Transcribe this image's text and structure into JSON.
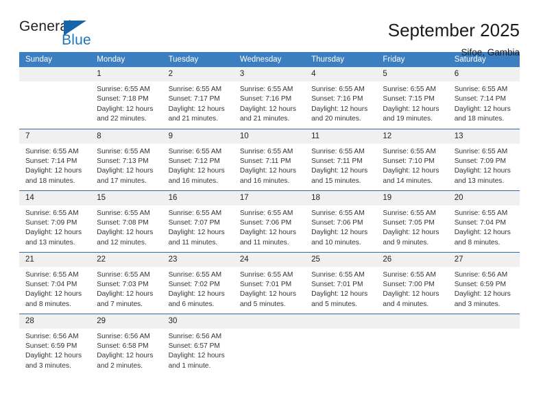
{
  "brand": {
    "name_part1": "General",
    "name_part2": "Blue",
    "flag_color": "#1565a8",
    "blue_color": "#1b75bb"
  },
  "header": {
    "title": "September 2025",
    "location": "Sifoe, Gambia",
    "header_bg": "#3c7fc1",
    "separator_color": "#2b6ca8",
    "daynum_bg": "#f0f0f0"
  },
  "weekdays": [
    "Sunday",
    "Monday",
    "Tuesday",
    "Wednesday",
    "Thursday",
    "Friday",
    "Saturday"
  ],
  "labels": {
    "sunrise": "Sunrise:",
    "sunset": "Sunset:",
    "daylight": "Daylight:"
  },
  "weeks": [
    [
      {
        "day": "",
        "empty": true
      },
      {
        "day": "1",
        "sunrise": "Sunrise: 6:55 AM",
        "sunset": "Sunset: 7:18 PM",
        "daylight": "Daylight: 12 hours and 22 minutes."
      },
      {
        "day": "2",
        "sunrise": "Sunrise: 6:55 AM",
        "sunset": "Sunset: 7:17 PM",
        "daylight": "Daylight: 12 hours and 21 minutes."
      },
      {
        "day": "3",
        "sunrise": "Sunrise: 6:55 AM",
        "sunset": "Sunset: 7:16 PM",
        "daylight": "Daylight: 12 hours and 21 minutes."
      },
      {
        "day": "4",
        "sunrise": "Sunrise: 6:55 AM",
        "sunset": "Sunset: 7:16 PM",
        "daylight": "Daylight: 12 hours and 20 minutes."
      },
      {
        "day": "5",
        "sunrise": "Sunrise: 6:55 AM",
        "sunset": "Sunset: 7:15 PM",
        "daylight": "Daylight: 12 hours and 19 minutes."
      },
      {
        "day": "6",
        "sunrise": "Sunrise: 6:55 AM",
        "sunset": "Sunset: 7:14 PM",
        "daylight": "Daylight: 12 hours and 18 minutes."
      }
    ],
    [
      {
        "day": "7",
        "sunrise": "Sunrise: 6:55 AM",
        "sunset": "Sunset: 7:14 PM",
        "daylight": "Daylight: 12 hours and 18 minutes."
      },
      {
        "day": "8",
        "sunrise": "Sunrise: 6:55 AM",
        "sunset": "Sunset: 7:13 PM",
        "daylight": "Daylight: 12 hours and 17 minutes."
      },
      {
        "day": "9",
        "sunrise": "Sunrise: 6:55 AM",
        "sunset": "Sunset: 7:12 PM",
        "daylight": "Daylight: 12 hours and 16 minutes."
      },
      {
        "day": "10",
        "sunrise": "Sunrise: 6:55 AM",
        "sunset": "Sunset: 7:11 PM",
        "daylight": "Daylight: 12 hours and 16 minutes."
      },
      {
        "day": "11",
        "sunrise": "Sunrise: 6:55 AM",
        "sunset": "Sunset: 7:11 PM",
        "daylight": "Daylight: 12 hours and 15 minutes."
      },
      {
        "day": "12",
        "sunrise": "Sunrise: 6:55 AM",
        "sunset": "Sunset: 7:10 PM",
        "daylight": "Daylight: 12 hours and 14 minutes."
      },
      {
        "day": "13",
        "sunrise": "Sunrise: 6:55 AM",
        "sunset": "Sunset: 7:09 PM",
        "daylight": "Daylight: 12 hours and 13 minutes."
      }
    ],
    [
      {
        "day": "14",
        "sunrise": "Sunrise: 6:55 AM",
        "sunset": "Sunset: 7:09 PM",
        "daylight": "Daylight: 12 hours and 13 minutes."
      },
      {
        "day": "15",
        "sunrise": "Sunrise: 6:55 AM",
        "sunset": "Sunset: 7:08 PM",
        "daylight": "Daylight: 12 hours and 12 minutes."
      },
      {
        "day": "16",
        "sunrise": "Sunrise: 6:55 AM",
        "sunset": "Sunset: 7:07 PM",
        "daylight": "Daylight: 12 hours and 11 minutes."
      },
      {
        "day": "17",
        "sunrise": "Sunrise: 6:55 AM",
        "sunset": "Sunset: 7:06 PM",
        "daylight": "Daylight: 12 hours and 11 minutes."
      },
      {
        "day": "18",
        "sunrise": "Sunrise: 6:55 AM",
        "sunset": "Sunset: 7:06 PM",
        "daylight": "Daylight: 12 hours and 10 minutes."
      },
      {
        "day": "19",
        "sunrise": "Sunrise: 6:55 AM",
        "sunset": "Sunset: 7:05 PM",
        "daylight": "Daylight: 12 hours and 9 minutes."
      },
      {
        "day": "20",
        "sunrise": "Sunrise: 6:55 AM",
        "sunset": "Sunset: 7:04 PM",
        "daylight": "Daylight: 12 hours and 8 minutes."
      }
    ],
    [
      {
        "day": "21",
        "sunrise": "Sunrise: 6:55 AM",
        "sunset": "Sunset: 7:04 PM",
        "daylight": "Daylight: 12 hours and 8 minutes."
      },
      {
        "day": "22",
        "sunrise": "Sunrise: 6:55 AM",
        "sunset": "Sunset: 7:03 PM",
        "daylight": "Daylight: 12 hours and 7 minutes."
      },
      {
        "day": "23",
        "sunrise": "Sunrise: 6:55 AM",
        "sunset": "Sunset: 7:02 PM",
        "daylight": "Daylight: 12 hours and 6 minutes."
      },
      {
        "day": "24",
        "sunrise": "Sunrise: 6:55 AM",
        "sunset": "Sunset: 7:01 PM",
        "daylight": "Daylight: 12 hours and 5 minutes."
      },
      {
        "day": "25",
        "sunrise": "Sunrise: 6:55 AM",
        "sunset": "Sunset: 7:01 PM",
        "daylight": "Daylight: 12 hours and 5 minutes."
      },
      {
        "day": "26",
        "sunrise": "Sunrise: 6:55 AM",
        "sunset": "Sunset: 7:00 PM",
        "daylight": "Daylight: 12 hours and 4 minutes."
      },
      {
        "day": "27",
        "sunrise": "Sunrise: 6:56 AM",
        "sunset": "Sunset: 6:59 PM",
        "daylight": "Daylight: 12 hours and 3 minutes."
      }
    ],
    [
      {
        "day": "28",
        "sunrise": "Sunrise: 6:56 AM",
        "sunset": "Sunset: 6:59 PM",
        "daylight": "Daylight: 12 hours and 3 minutes."
      },
      {
        "day": "29",
        "sunrise": "Sunrise: 6:56 AM",
        "sunset": "Sunset: 6:58 PM",
        "daylight": "Daylight: 12 hours and 2 minutes."
      },
      {
        "day": "30",
        "sunrise": "Sunrise: 6:56 AM",
        "sunset": "Sunset: 6:57 PM",
        "daylight": "Daylight: 12 hours and 1 minute."
      },
      {
        "day": "",
        "empty": true
      },
      {
        "day": "",
        "empty": true
      },
      {
        "day": "",
        "empty": true
      },
      {
        "day": "",
        "empty": true
      }
    ]
  ]
}
